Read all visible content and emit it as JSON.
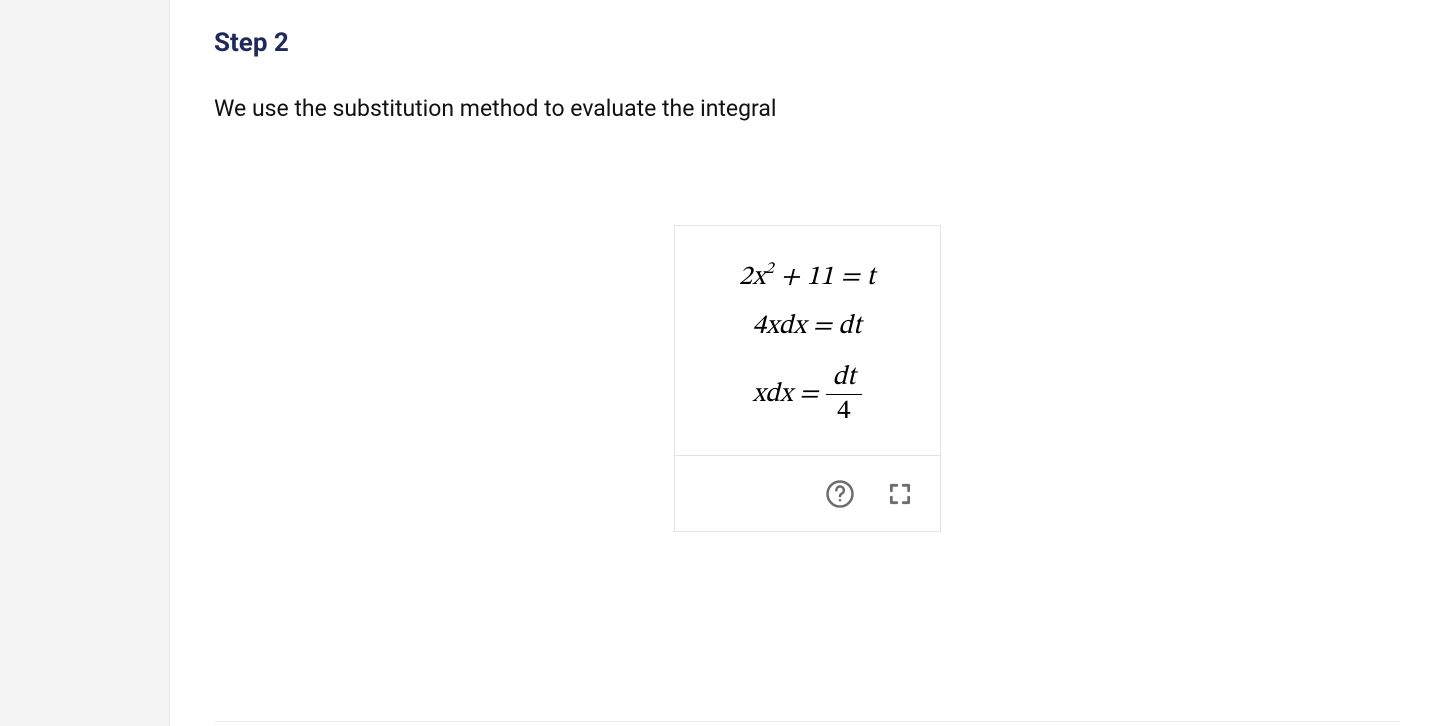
{
  "step": {
    "heading": "Step 2"
  },
  "body": {
    "intro": "We use the substitution method to evaluate the integral"
  },
  "math": {
    "line1_html": "2<i>x</i><sup>2</sup> + 11 = <i>t</i>",
    "line2_html": "4<i>xdx</i> = <i>dt</i>",
    "line3_lhs_html": "<i>xdx</i> =",
    "frac_num": "dt",
    "frac_den": "4"
  },
  "icons": {
    "help": "help-circle-icon",
    "fullscreen": "fullscreen-icon"
  }
}
